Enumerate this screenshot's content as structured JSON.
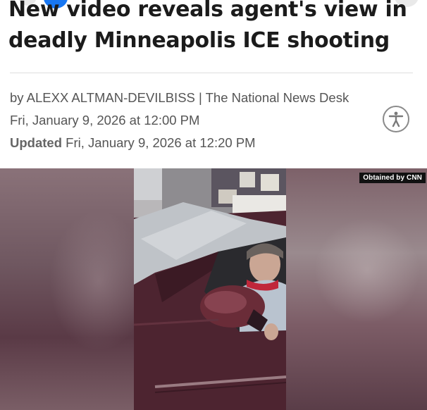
{
  "article": {
    "headline_line1": "New video reveals agent's view in",
    "headline_line2": "deadly Minneapolis ICE shooting",
    "byline": "by ALEXX ALTMAN-DEVILBISS | The National News Desk",
    "published": "Fri, January 9, 2026 at 12:00 PM",
    "updated_label": "Updated",
    "updated_date": "Fri, January 9, 2026 at 12:20 PM"
  },
  "video": {
    "credit_badge": "Obtained by CNN"
  },
  "icons": {
    "accessibility": "accessibility-icon"
  },
  "colors": {
    "headline": "#1b1b1b",
    "meta_text": "#555555",
    "car_body": "#5a2a36",
    "badge_bg": "#111111"
  }
}
